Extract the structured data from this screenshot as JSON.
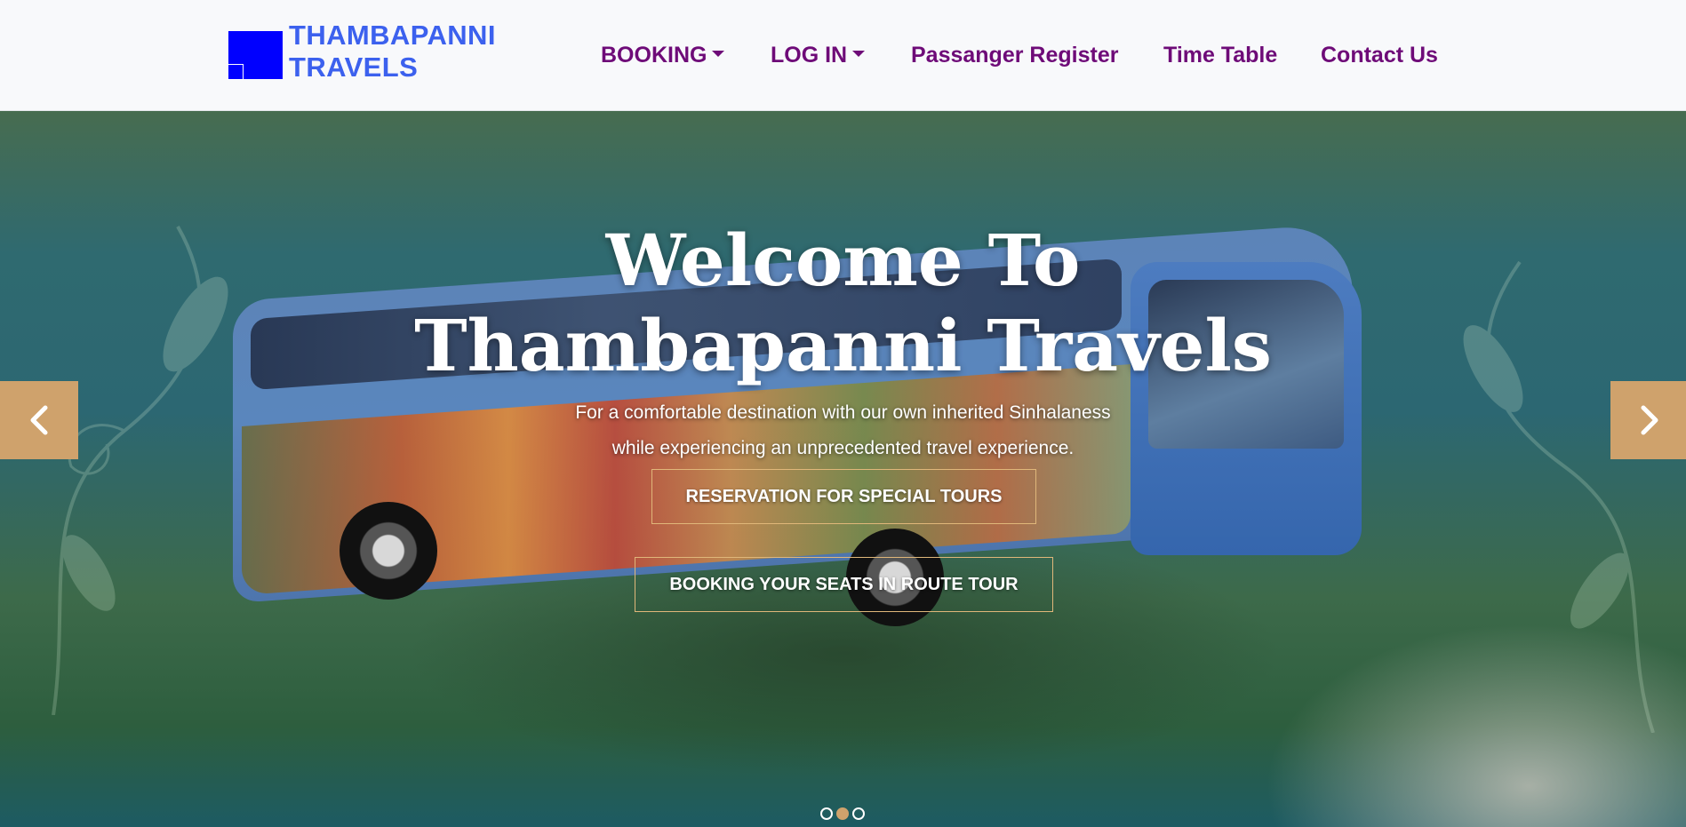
{
  "brand": {
    "line1": "THAMBAPANNI",
    "line2": "TRAVELS"
  },
  "nav": [
    {
      "label": "BOOKING",
      "has_dropdown": true
    },
    {
      "label": "LOG IN",
      "has_dropdown": true
    },
    {
      "label": "Passanger Register",
      "has_dropdown": false
    },
    {
      "label": "Time Table",
      "has_dropdown": false
    },
    {
      "label": "Contact Us",
      "has_dropdown": false
    }
  ],
  "hero": {
    "title_line1": "Welcome To",
    "title_line2": "Thambapanni Travels",
    "subtitle_line1": "For a comfortable destination with our own inherited Sinhalaness",
    "subtitle_line2": "while experiencing an unprecedented travel experience.",
    "cta_primary": "RESERVATION FOR SPECIAL TOURS",
    "cta_secondary": "BOOKING YOUR SEATS IN ROUTE TOUR"
  },
  "carousel": {
    "prev_icon": "chevron-left-icon",
    "next_icon": "chevron-right-icon",
    "slide_count": 3,
    "active_index": 1
  },
  "colors": {
    "brand": "#3c61ee",
    "logo": "#0000ff",
    "nav_link": "#6e0b78",
    "accent": "#cfa26c",
    "cta_border": "#e0b77a"
  }
}
